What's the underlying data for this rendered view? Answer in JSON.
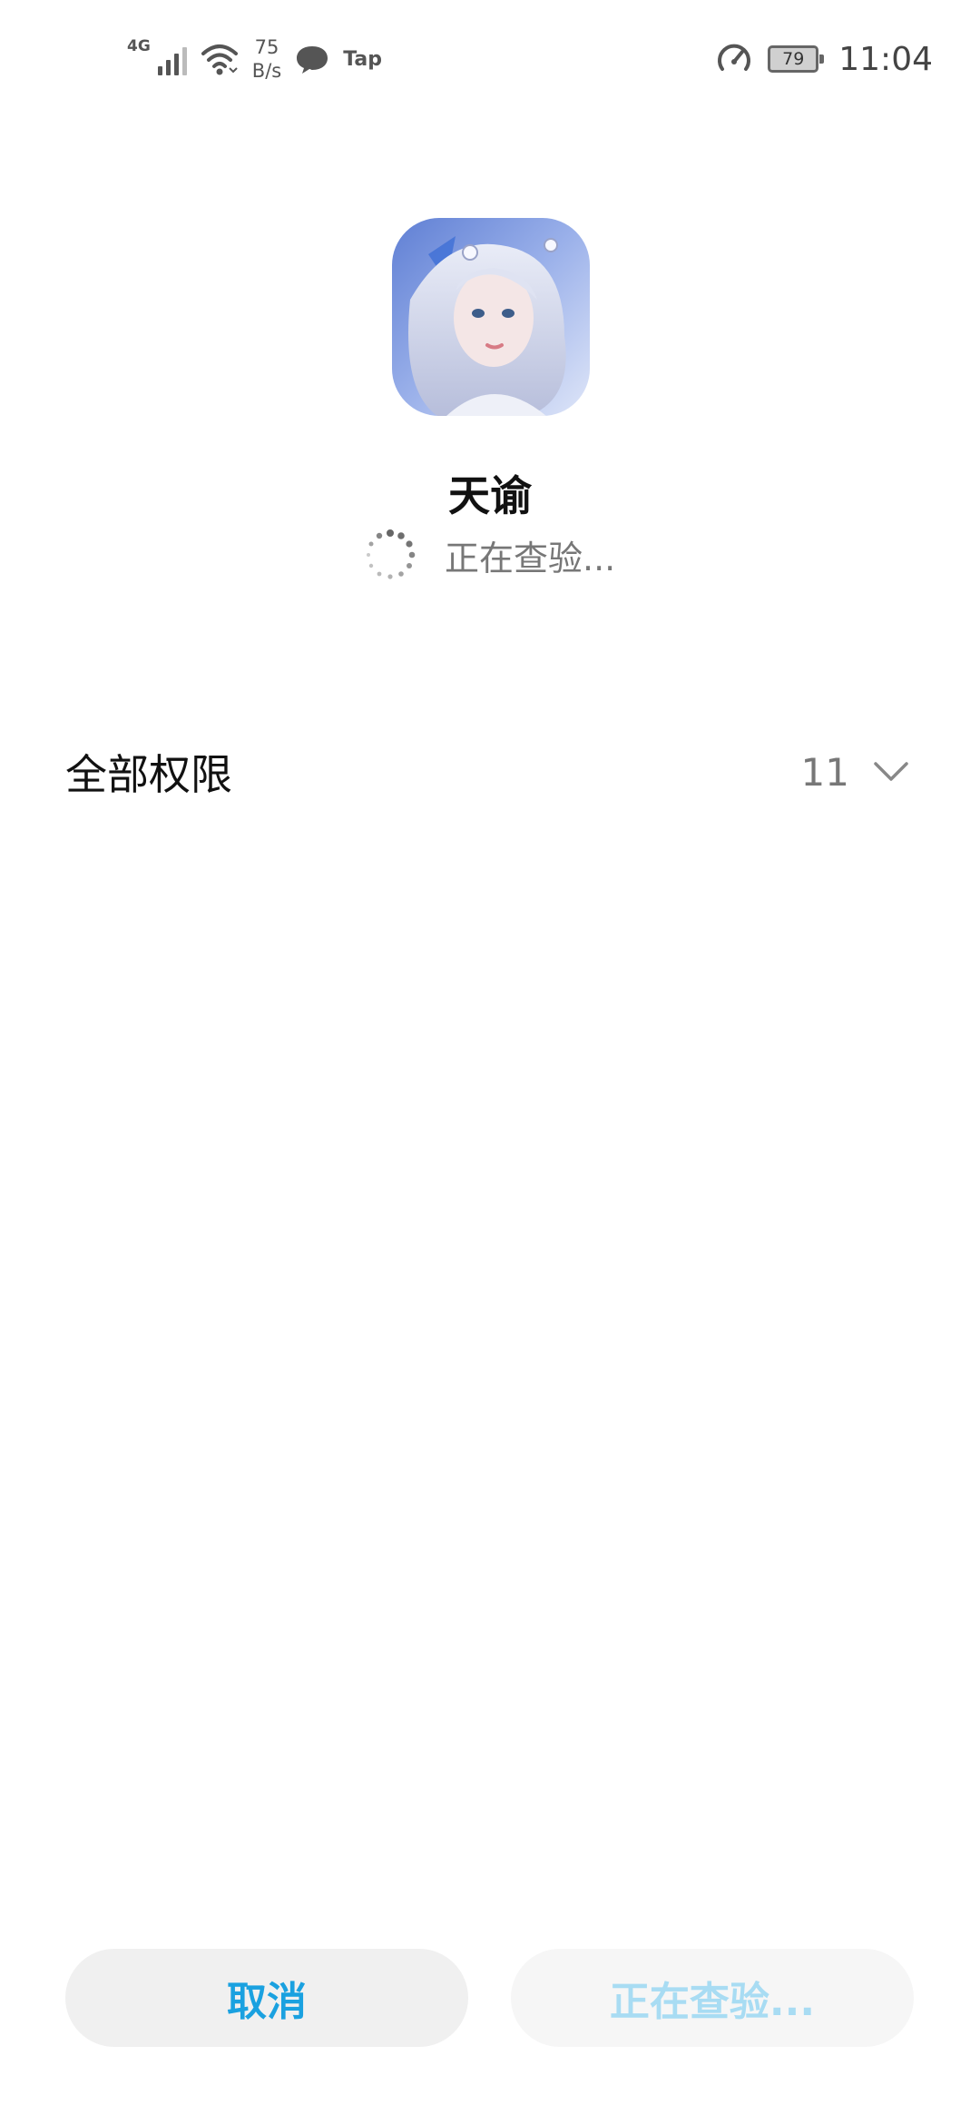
{
  "status_bar": {
    "network_type": "4G",
    "speed_value": "75",
    "speed_unit": "B/s",
    "tap_label": "Tap",
    "battery_level": "79",
    "time": "11:04",
    "icons": [
      "signal-icon",
      "wifi-icon",
      "message-icon",
      "gauge-icon",
      "battery-icon"
    ]
  },
  "app": {
    "name": "天谕",
    "status": "正在查验..."
  },
  "permissions": {
    "title": "全部权限",
    "count": "11"
  },
  "buttons": {
    "cancel": "取消",
    "checking": "正在查验..."
  },
  "colors": {
    "accent": "#1aa1e0",
    "accent_disabled": "#a8dcf3"
  }
}
